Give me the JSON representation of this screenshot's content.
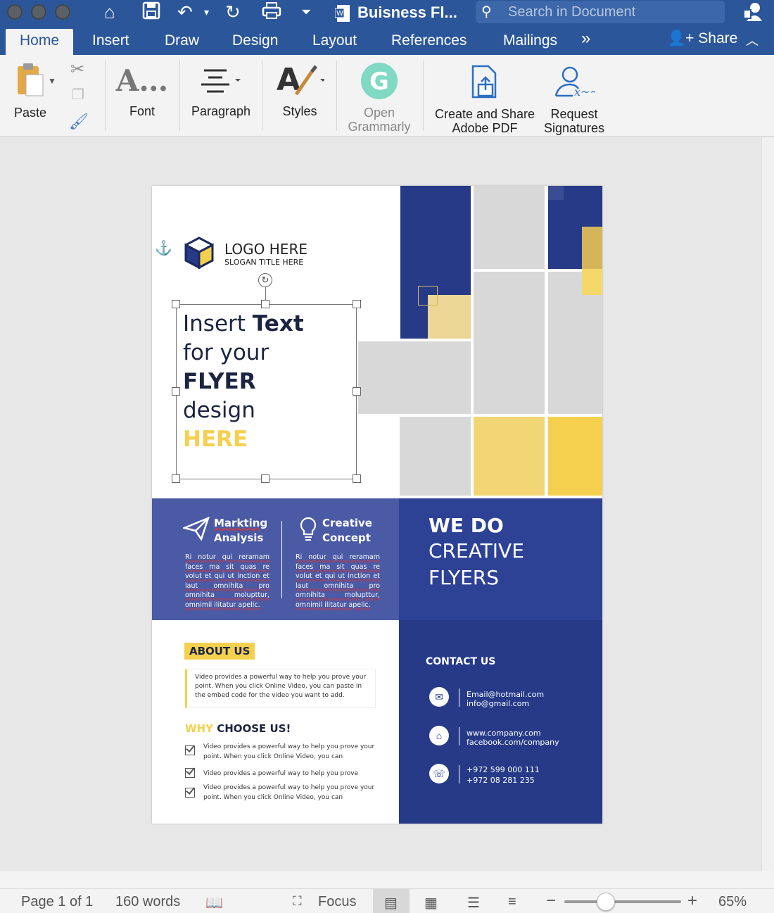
{
  "window": {
    "doc_title": "Buisness Fl...",
    "search_placeholder": "Search in Document"
  },
  "tabs": [
    {
      "label": "Home"
    },
    {
      "label": "Insert"
    },
    {
      "label": "Draw"
    },
    {
      "label": "Design"
    },
    {
      "label": "Layout"
    },
    {
      "label": "References"
    },
    {
      "label": "Mailings"
    }
  ],
  "tabs_more": "»",
  "share_label": "Share",
  "ribbon": {
    "paste": "Paste",
    "font": "Font",
    "paragraph": "Paragraph",
    "styles": "Styles",
    "grammarly_1": "Open",
    "grammarly_2": "Grammarly",
    "pdf_1": "Create and Share",
    "pdf_2": "Adobe PDF",
    "sig_1": "Request",
    "sig_2": "Signatures"
  },
  "flyer": {
    "logo_title": "LOGO HERE",
    "logo_slogan": "SLOGAN TITLE HERE",
    "headline_1a": "Insert ",
    "headline_1b": "Text",
    "headline_2": "for your",
    "headline_3": "FLYER",
    "headline_4": "design",
    "headline_5": "HERE",
    "feature_1_a": "Markting",
    "feature_1_b": "Analysis",
    "feature_2_a": "Creative",
    "feature_2_b": "Concept",
    "lorem": "Ri notur qui reramam faces ma sit quas re volut et qui ut inction et laut omnihita pro omnihita molupttur, omnimil ilitatur apelic.",
    "we_do_1": "WE DO",
    "we_do_2": "CREATIVE",
    "we_do_3": "FLYERS",
    "about_title": "ABOUT US",
    "about_text": "Video provides a powerful way to help you prove your point. When you click Online Video, you can paste in the embed code for the video you want to add.",
    "why_a": "WHY",
    "why_b": " CHOOSE US!",
    "checks": [
      "Video provides a powerful way to help you prove your point. When you click Online Video, you can",
      "Video provides a powerful way to help you prove",
      "Video provides a powerful way to help you prove your point. When you click Online Video, you can"
    ],
    "contact_title": "CONTACT US",
    "email_1": "Email@hotmail.com",
    "email_2": "info@gmail.com",
    "web_1": "www.company.com",
    "web_2": "facebook.com/company",
    "phone_1": "+972 599 000 111",
    "phone_2": "+972 08 281 235"
  },
  "status": {
    "page": "Page 1 of 1",
    "words": "160 words",
    "focus": "Focus",
    "zoom_minus": "−",
    "zoom_plus": "+",
    "zoom": "65%"
  },
  "colors": {
    "navy": "#263a88",
    "yellow": "#f5d04f",
    "word_blue": "#2b579a"
  },
  "zoom_level": 0.65
}
